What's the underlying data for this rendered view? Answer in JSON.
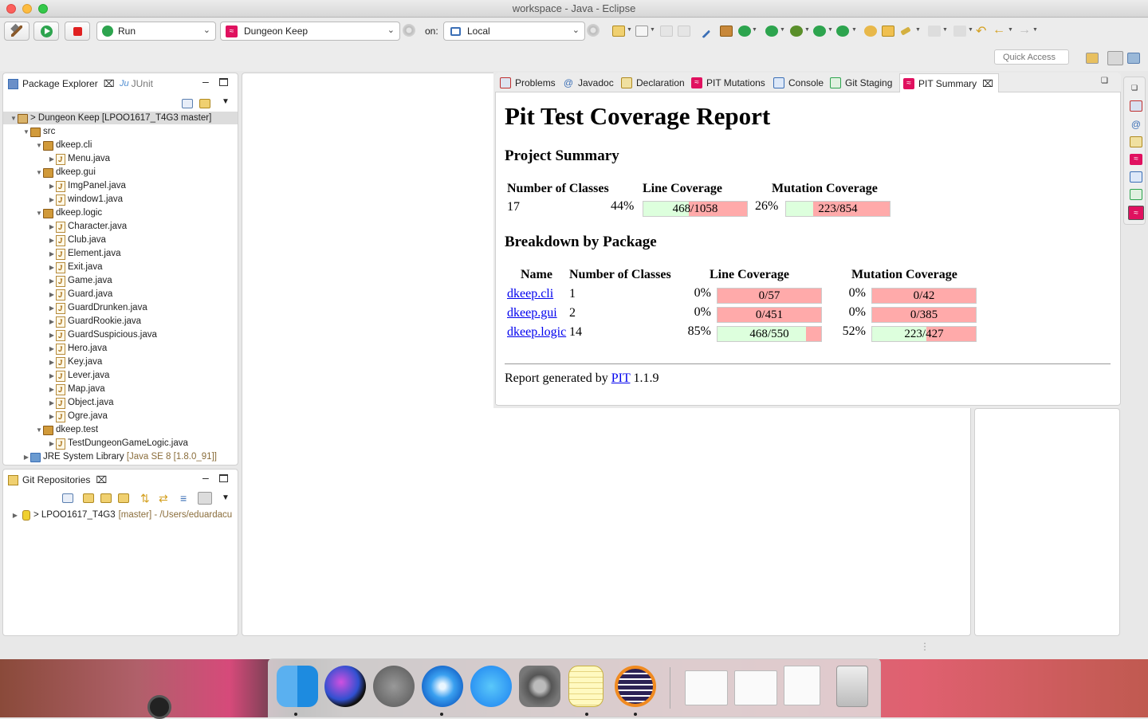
{
  "window": {
    "title": "workspace - Java - Eclipse"
  },
  "toolbar": {
    "launch_mode": "Run",
    "launch_config": "Dungeon Keep",
    "on_label": "on:",
    "target": "Local",
    "quick_access_placeholder": "Quick Access"
  },
  "package_explorer": {
    "tabs": [
      {
        "label": "Package Explorer"
      },
      {
        "label": "JUnit"
      }
    ],
    "project": "> Dungeon Keep [LPOO1617_T4G3 master]",
    "src": "src",
    "packages": [
      {
        "name": "dkeep.cli",
        "files": [
          "Menu.java"
        ]
      },
      {
        "name": "dkeep.gui",
        "files": [
          "ImgPanel.java",
          "window1.java"
        ]
      },
      {
        "name": "dkeep.logic",
        "files": [
          "Character.java",
          "Club.java",
          "Element.java",
          "Exit.java",
          "Game.java",
          "Guard.java",
          "GuardDrunken.java",
          "GuardRookie.java",
          "GuardSuspicious.java",
          "Hero.java",
          "Key.java",
          "Lever.java",
          "Map.java",
          "Object.java",
          "Ogre.java"
        ]
      },
      {
        "name": "dkeep.test",
        "files": [
          "TestDungeonGameLogic.java"
        ]
      }
    ],
    "jre_label": "JRE System Library",
    "jre_detail": "[Java SE 8 [1.8.0_91]]"
  },
  "git_repositories": {
    "tab": "Git Repositories",
    "repo_name": "> LPOO1617_T4G3",
    "repo_detail": "[master] - /Users/eduardacu"
  },
  "editor_tabs": [
    {
      "label": "Problems"
    },
    {
      "label": "Javadoc"
    },
    {
      "label": "Declaration"
    },
    {
      "label": "PIT Mutations"
    },
    {
      "label": "Console"
    },
    {
      "label": "Git Staging"
    },
    {
      "label": "PIT Summary"
    }
  ],
  "report": {
    "title": "Pit Test Coverage Report",
    "project_summary_heading": "Project Summary",
    "summary_headers": {
      "classes": "Number of Classes",
      "line": "Line Coverage",
      "mutation": "Mutation Coverage"
    },
    "summary": {
      "classes": "17",
      "line_pct": "44%",
      "line_fraction": 0.4423,
      "line_text": "468/1058",
      "mut_pct": "26%",
      "mut_fraction": 0.2611,
      "mut_text": "223/854"
    },
    "breakdown_heading": "Breakdown by Package",
    "breakdown_headers": {
      "name": "Name",
      "classes": "Number of Classes",
      "line": "Line Coverage",
      "mutation": "Mutation Coverage"
    },
    "packages": [
      {
        "name": "dkeep.cli",
        "classes": "1",
        "line_pct": "0%",
        "line_fraction": 0,
        "line_text": "0/57",
        "mut_pct": "0%",
        "mut_fraction": 0,
        "mut_text": "0/42"
      },
      {
        "name": "dkeep.gui",
        "classes": "2",
        "line_pct": "0%",
        "line_fraction": 0,
        "line_text": "0/451",
        "mut_pct": "0%",
        "mut_fraction": 0,
        "mut_text": "0/385"
      },
      {
        "name": "dkeep.logic",
        "classes": "14",
        "line_pct": "85%",
        "line_fraction": 0.851,
        "line_text": "468/550",
        "mut_pct": "52%",
        "mut_fraction": 0.522,
        "mut_text": "223/427"
      }
    ],
    "footer_prefix": "Report generated by",
    "footer_link": "PIT",
    "footer_version": "1.1.9"
  },
  "colors": {
    "pit_accent": "#e0115f",
    "covered": "#ddffdd",
    "uncovered": "#ffaaaa"
  }
}
